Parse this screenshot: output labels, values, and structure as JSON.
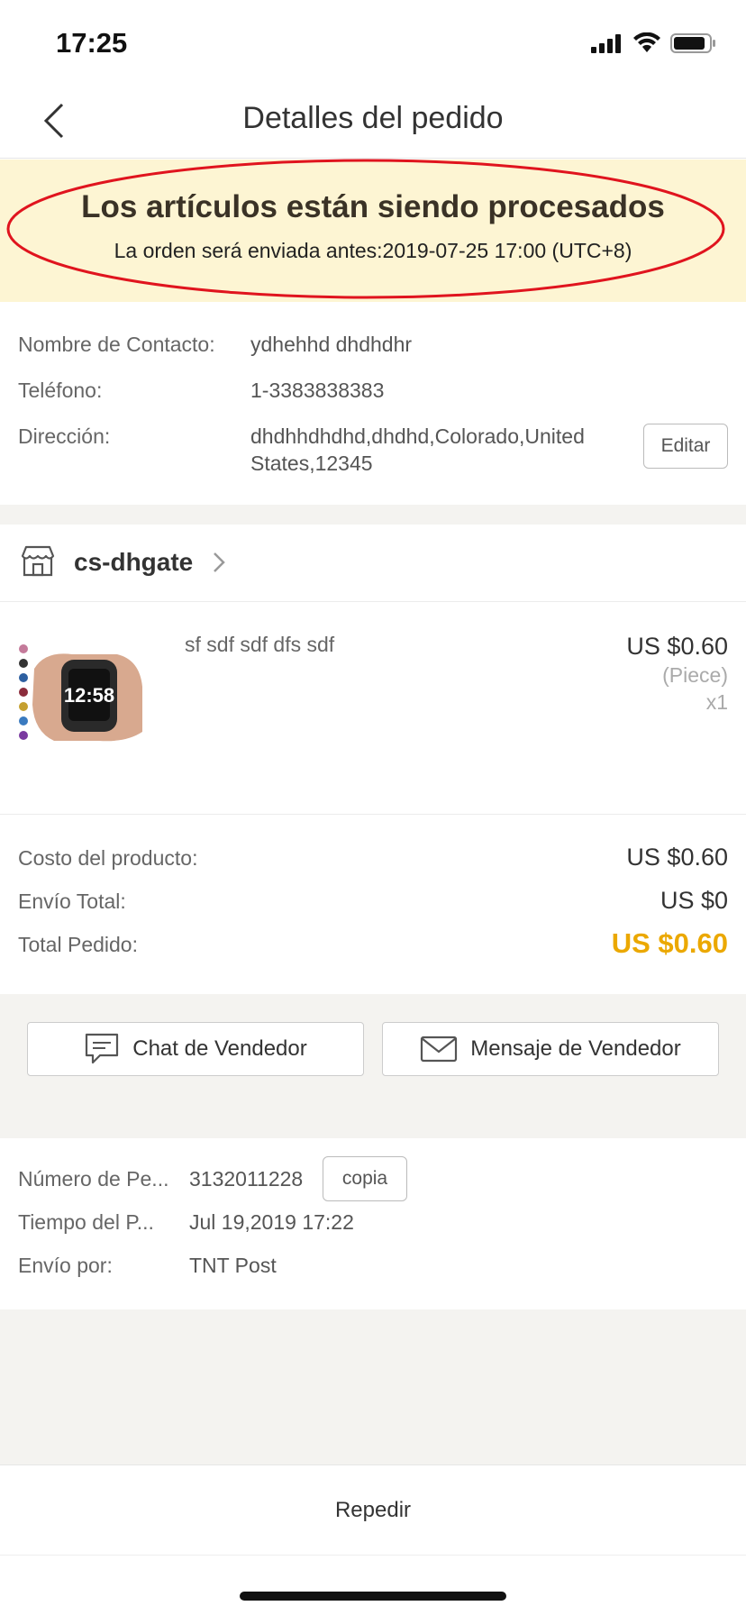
{
  "status_bar": {
    "time": "17:25"
  },
  "nav": {
    "title": "Detalles del pedido"
  },
  "banner": {
    "title": "Los artículos están siendo procesados",
    "subtitle": "La orden será enviada antes:2019-07-25 17:00 (UTC+8)",
    "highlight_color": "#e0141e"
  },
  "address": {
    "contact_label": "Nombre de Contacto:",
    "contact_value": "ydhehhd dhdhdhr",
    "phone_label": "Teléfono:",
    "phone_value": "1-3383838383",
    "address_label": "Dirección:",
    "address_value": "dhdhhdhdhd,dhdhd,Colorado,United States,12345",
    "edit_label": "Editar"
  },
  "store": {
    "name": "cs-dhgate"
  },
  "product": {
    "name": "sf sdf sdf dfs sdf",
    "price": "US $0.60",
    "unit": "(Piece)",
    "quantity": "x1",
    "watch_time": "12:58"
  },
  "costs": {
    "product_cost_label": "Costo del producto:",
    "product_cost_value": "US $0.60",
    "shipping_label": "Envío Total:",
    "shipping_value": "US $0",
    "total_label": "Total Pedido:",
    "total_value": "US $0.60",
    "total_color": "#eba800"
  },
  "actions": {
    "chat_label": "Chat de Vendedor",
    "message_label": "Mensaje de Vendedor"
  },
  "order_info": {
    "number_label": "Número de Pe...",
    "number_value": "3132011228",
    "copy_label": "copia",
    "time_label": "Tiempo del P...",
    "time_value": "Jul 19,2019 17:22",
    "shipping_label": "Envío por:",
    "shipping_value": "TNT Post"
  },
  "bottom": {
    "reorder_label": "Repedir"
  }
}
